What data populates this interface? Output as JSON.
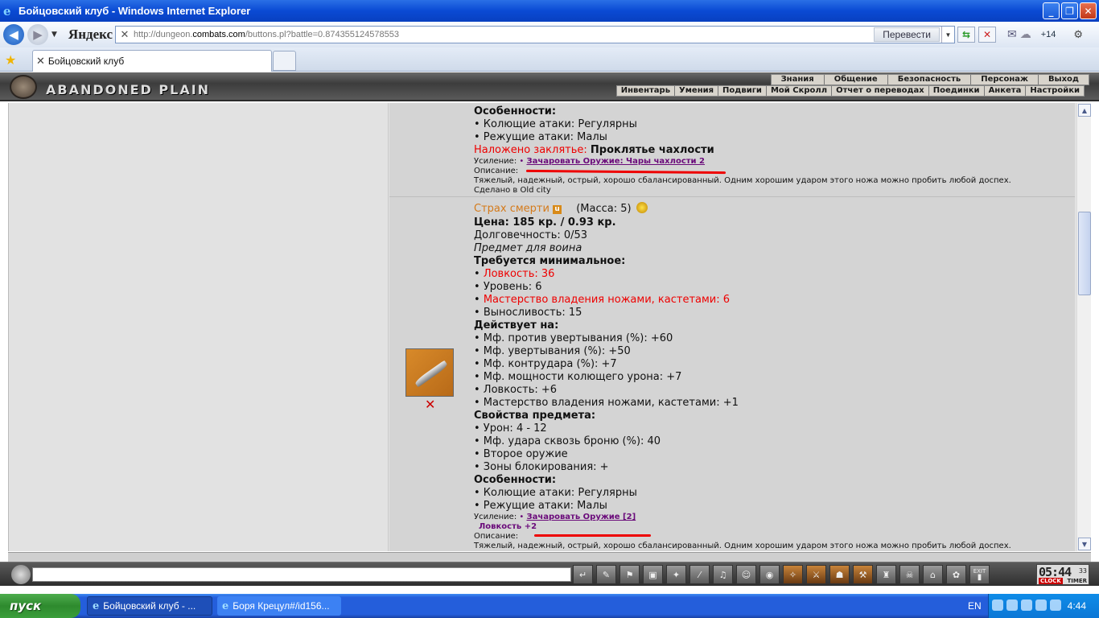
{
  "window": {
    "title": "Бойцовский клуб - Windows Internet Explorer",
    "controls": [
      "_",
      "❐",
      "✕"
    ]
  },
  "nav": {
    "yandex_logo": "Яндекс",
    "url_prefix": "http://dungeon.",
    "url_domain": "combats.com",
    "url_suffix": "/buttons.pl?battle=0.874355124578553",
    "translate_label": "Перевести",
    "weather": "+14"
  },
  "tab": {
    "label": "Бойцовский клуб"
  },
  "game": {
    "title": "ABANDONED PLAIN",
    "menu_top": [
      "Знания",
      "Общение",
      "Безопасность",
      "Персонаж",
      "Выход"
    ],
    "menu_bottom": [
      "Инвентарь",
      "Умения",
      "Подвиги",
      "Мой Скролл",
      "Отчет о переводах",
      "Поединки",
      "Анкета",
      "Настройки"
    ]
  },
  "item1": {
    "lines": {
      "features": "Особенности:",
      "stab": "• Колющие атаки: Регулярны",
      "cut": "• Режущие атаки: Малы",
      "spell_label": "Наложено заклятье:",
      "spell_value": "Проклятье чахлости",
      "enh_label": "Усиление:",
      "enh_dot": "•",
      "enh_link": "Зачаровать Оружие: Чары чахлости 2",
      "desc_label": "Описание:",
      "desc_text": "Тяжелый, надежный, острый, хорошо сбалансированный. Одним хорошим ударом этого ножа можно пробить любой доспех.",
      "made_in": "Сделано в Old city"
    }
  },
  "item2": {
    "name": "Страх смерти",
    "badge": "u",
    "mass": "(Масса: 5)",
    "price": "Цена: 185 кр. / 0.93 кр.",
    "durability": "Долговечность: 0/53",
    "for_class": "Предмет для воина",
    "req_title": "Требуется минимальное:",
    "req": [
      {
        "text": "Ловкость: 36",
        "red": true
      },
      {
        "text": "Уровень: 6",
        "red": false
      },
      {
        "text": "Мастерство владения ножами, кастетами: 6",
        "red": true
      },
      {
        "text": "Выносливость: 15",
        "red": false
      }
    ],
    "acts_title": "Действует на:",
    "acts": [
      "• Мф. против увертывания (%): +60",
      "• Мф. увертывания (%): +50",
      "• Мф. контрудара (%): +7",
      "• Мф. мощности колющего урона: +7",
      "• Ловкость: +6",
      "• Мастерство владения ножами, кастетами: +1"
    ],
    "props_title": "Свойства предмета:",
    "props": [
      "• Урон: 4 - 12",
      "• Мф. удара сквозь броню (%): 40",
      "• Второе оружие",
      "• Зоны блокирования: +"
    ],
    "features_title": "Особенности:",
    "features": [
      "• Колющие атаки: Регулярны",
      "• Режущие атаки: Малы"
    ],
    "enh_label": "Усиление:",
    "enh_dot": "•",
    "enh_link": "Зачаровать Оружие [2]",
    "enh_bonus": "Ловкость +2",
    "desc_label": "Описание:",
    "desc_text": "Тяжелый, надежный, острый, хорошо сбалансированный. Одним хорошим ударом этого ножа можно пробить любой доспех.",
    "delete_icon": "✕"
  },
  "bottombar": {
    "icons": [
      "↵",
      "✎",
      "⚑",
      "▣",
      "✦",
      "⁄",
      "♫",
      "☺",
      "◉",
      "✧",
      "⚔",
      "☗",
      "⚒",
      "♜",
      "☠",
      "⌂",
      "✿",
      "▮"
    ],
    "clock_time": "05:44",
    "clock_sec": "33",
    "clock_label": "CLOCK",
    "timer_label": "TIMER",
    "exit_label": "EXIT"
  },
  "taskbar": {
    "start": "пуск",
    "tasks": [
      "Бойцовский клуб - ...",
      "Боря Крецул#/id156..."
    ],
    "lang": "EN",
    "time": "4:44"
  }
}
